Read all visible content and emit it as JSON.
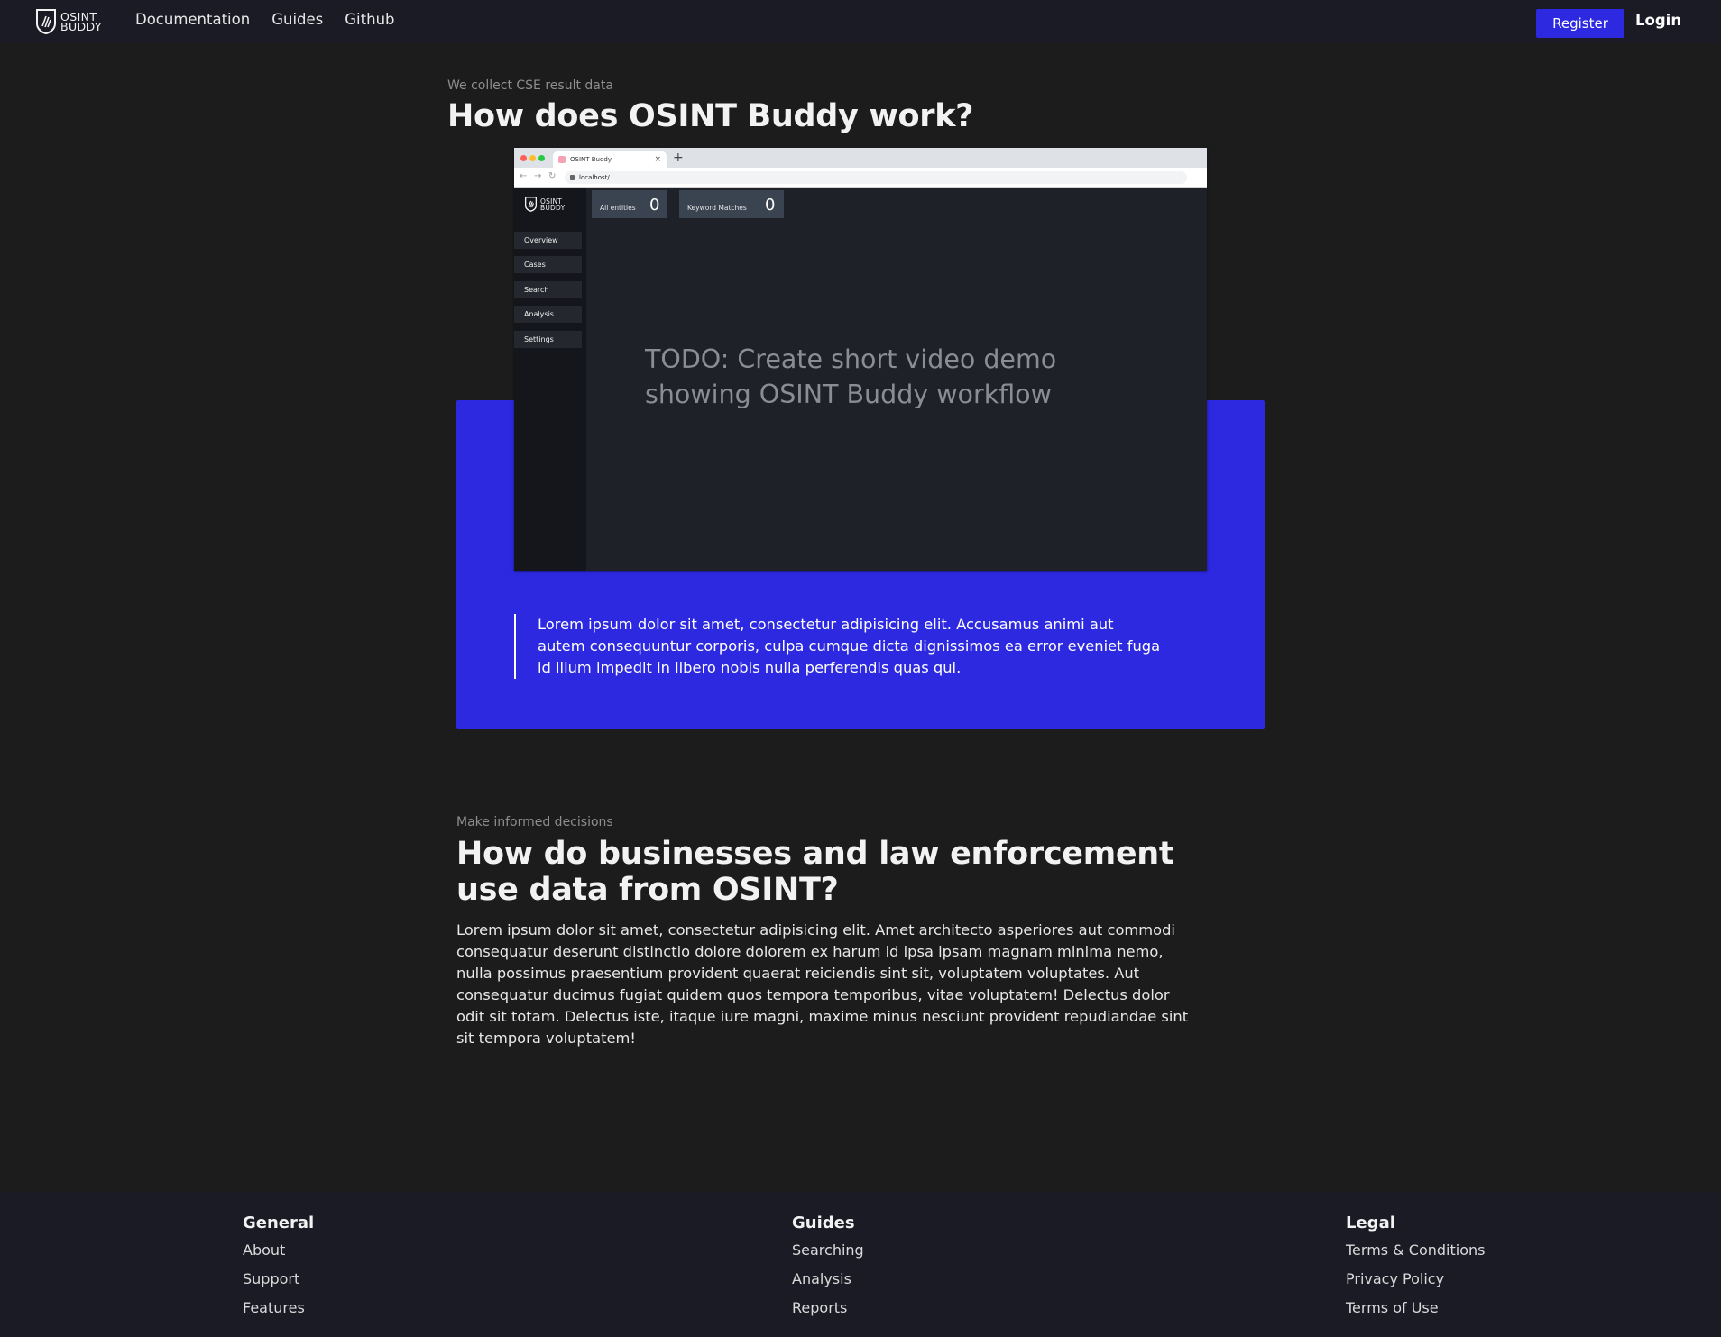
{
  "nav": {
    "brand": {
      "line1": "OSINT",
      "line2": "BUDDY"
    },
    "links": [
      "Documentation",
      "Guides",
      "Github"
    ],
    "register": "Register",
    "login": "Login",
    "accent": "#2c29e0"
  },
  "section1": {
    "eyebrow": "We collect CSE result data",
    "title": "How does OSINT Buddy work?",
    "quote": "Lorem ipsum dolor sit amet, consectetur adipisicing elit. Accusamus animi aut autem consequuntur corporis, culpa cumque dicta dignissimos ea error eveniet fuga id illum impedit in libero nobis nulla perferendis quas qui."
  },
  "mock": {
    "tab_title": "OSINT Buddy",
    "url": "localhost/",
    "logo": {
      "line1": "OSINT",
      "line2": "BUDDY"
    },
    "sidebar": [
      "Overview",
      "Cases",
      "Search",
      "Analysis",
      "Settings"
    ],
    "stats": [
      {
        "label": "All entities",
        "value": "0"
      },
      {
        "label": "Keyword Matches",
        "value": "0"
      }
    ],
    "todo": "TODO: Create short video demo showing OSINT Buddy workflow"
  },
  "section2": {
    "eyebrow": "Make informed decisions",
    "title": "How do businesses and law enforcement use data from OSINT?",
    "body": "Lorem ipsum dolor sit amet, consectetur adipisicing elit. Amet architecto asperiores aut commodi consequatur deserunt distinctio dolore dolorem ex harum id ipsa ipsam magnam minima nemo, nulla possimus praesentium provident quaerat reiciendis sint sit, voluptatem voluptates. Aut consequatur ducimus fugiat quidem quos tempora temporibus, vitae voluptatem! Delectus dolor odit sit totam. Delectus iste, itaque iure magni, maxime minus nesciunt provident repudiandae sint sit tempora voluptatem!"
  },
  "footer": {
    "general": {
      "title": "General",
      "links": [
        "About",
        "Support",
        "Features"
      ]
    },
    "guides": {
      "title": "Guides",
      "links": [
        "Searching",
        "Analysis",
        "Reports"
      ]
    },
    "legal": {
      "title": "Legal",
      "links": [
        "Terms & Conditions",
        "Privacy Policy",
        "Terms of Use"
      ]
    }
  }
}
